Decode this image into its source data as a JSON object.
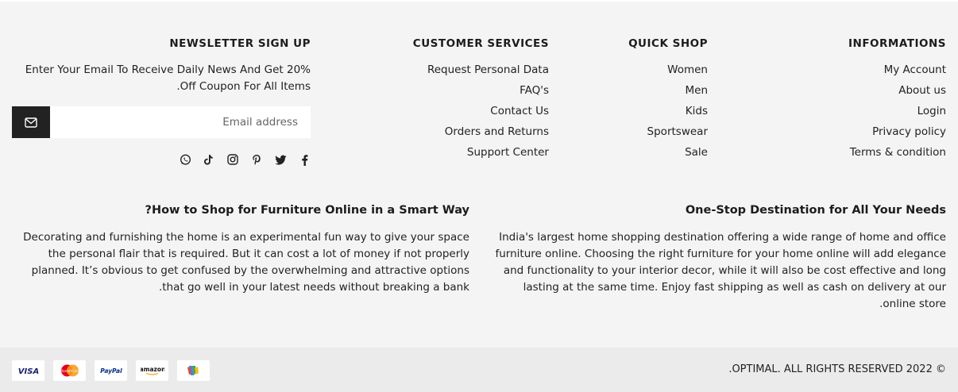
{
  "informations": {
    "title": "INFORMATIONS",
    "items": [
      "My Account",
      "About us",
      "Login",
      "Privacy policy",
      "Terms & condition"
    ]
  },
  "quick_shop": {
    "title": "QUICK SHOP",
    "items": [
      "Women",
      "Men",
      "Kids",
      "Sportswear",
      "Sale"
    ]
  },
  "customer_services": {
    "title": "CUSTOMER SERVICES",
    "items": [
      "Request Personal Data",
      "FAQ's",
      "Contact Us",
      "Orders and Returns",
      "Support Center"
    ]
  },
  "newsletter": {
    "title": "NEWSLETTER SIGN UP",
    "text": "Enter Your Email To Receive Daily News And Get 20% Off Coupon For All Items.",
    "placeholder": "Email address",
    "button_icon": "envelope-icon"
  },
  "social_icons": [
    "whatsapp-icon",
    "tiktok-icon",
    "instagram-icon",
    "pinterest-icon",
    "twitter-icon",
    "facebook-icon"
  ],
  "articles": {
    "right": {
      "title": "One-Stop Destination for All Your Needs",
      "body": "India's largest home shopping destination offering a wide range of home and office furniture online. Choosing the right furniture for your home online will add elegance and functionality to your interior decor, while it will also be cost effective and long lasting at the same time. Enjoy fast shipping as well as cash on delivery at our online store."
    },
    "left": {
      "title": "How to Shop for Furniture Online in a Smart Way?",
      "body": "Decorating and furnishing the home is an experimental fun way to give your space the personal flair that is required. But it can cost a lot of money if not properly planned. It’s obvious to get confused by the overwhelming and attractive options that go well in your latest needs without breaking a bank."
    },
    "left_title_display": "?How to Shop for Furniture Online in a Smart Way"
  },
  "footer": {
    "copyright": "© 2022 OPTIMAL. ALL RIGHTS RESERVED.",
    "payments": [
      "VISA",
      "MasterCard",
      "PayPal",
      "amazon",
      "Google Wallet"
    ]
  },
  "colors": {
    "background": "#f4f4f4",
    "bottom_bar": "#ebebeb",
    "dark": "#222222",
    "visa": "#1a1f71",
    "mastercard_red": "#eb001b",
    "mastercard_yellow": "#f79e1b",
    "paypal": "#003087"
  }
}
